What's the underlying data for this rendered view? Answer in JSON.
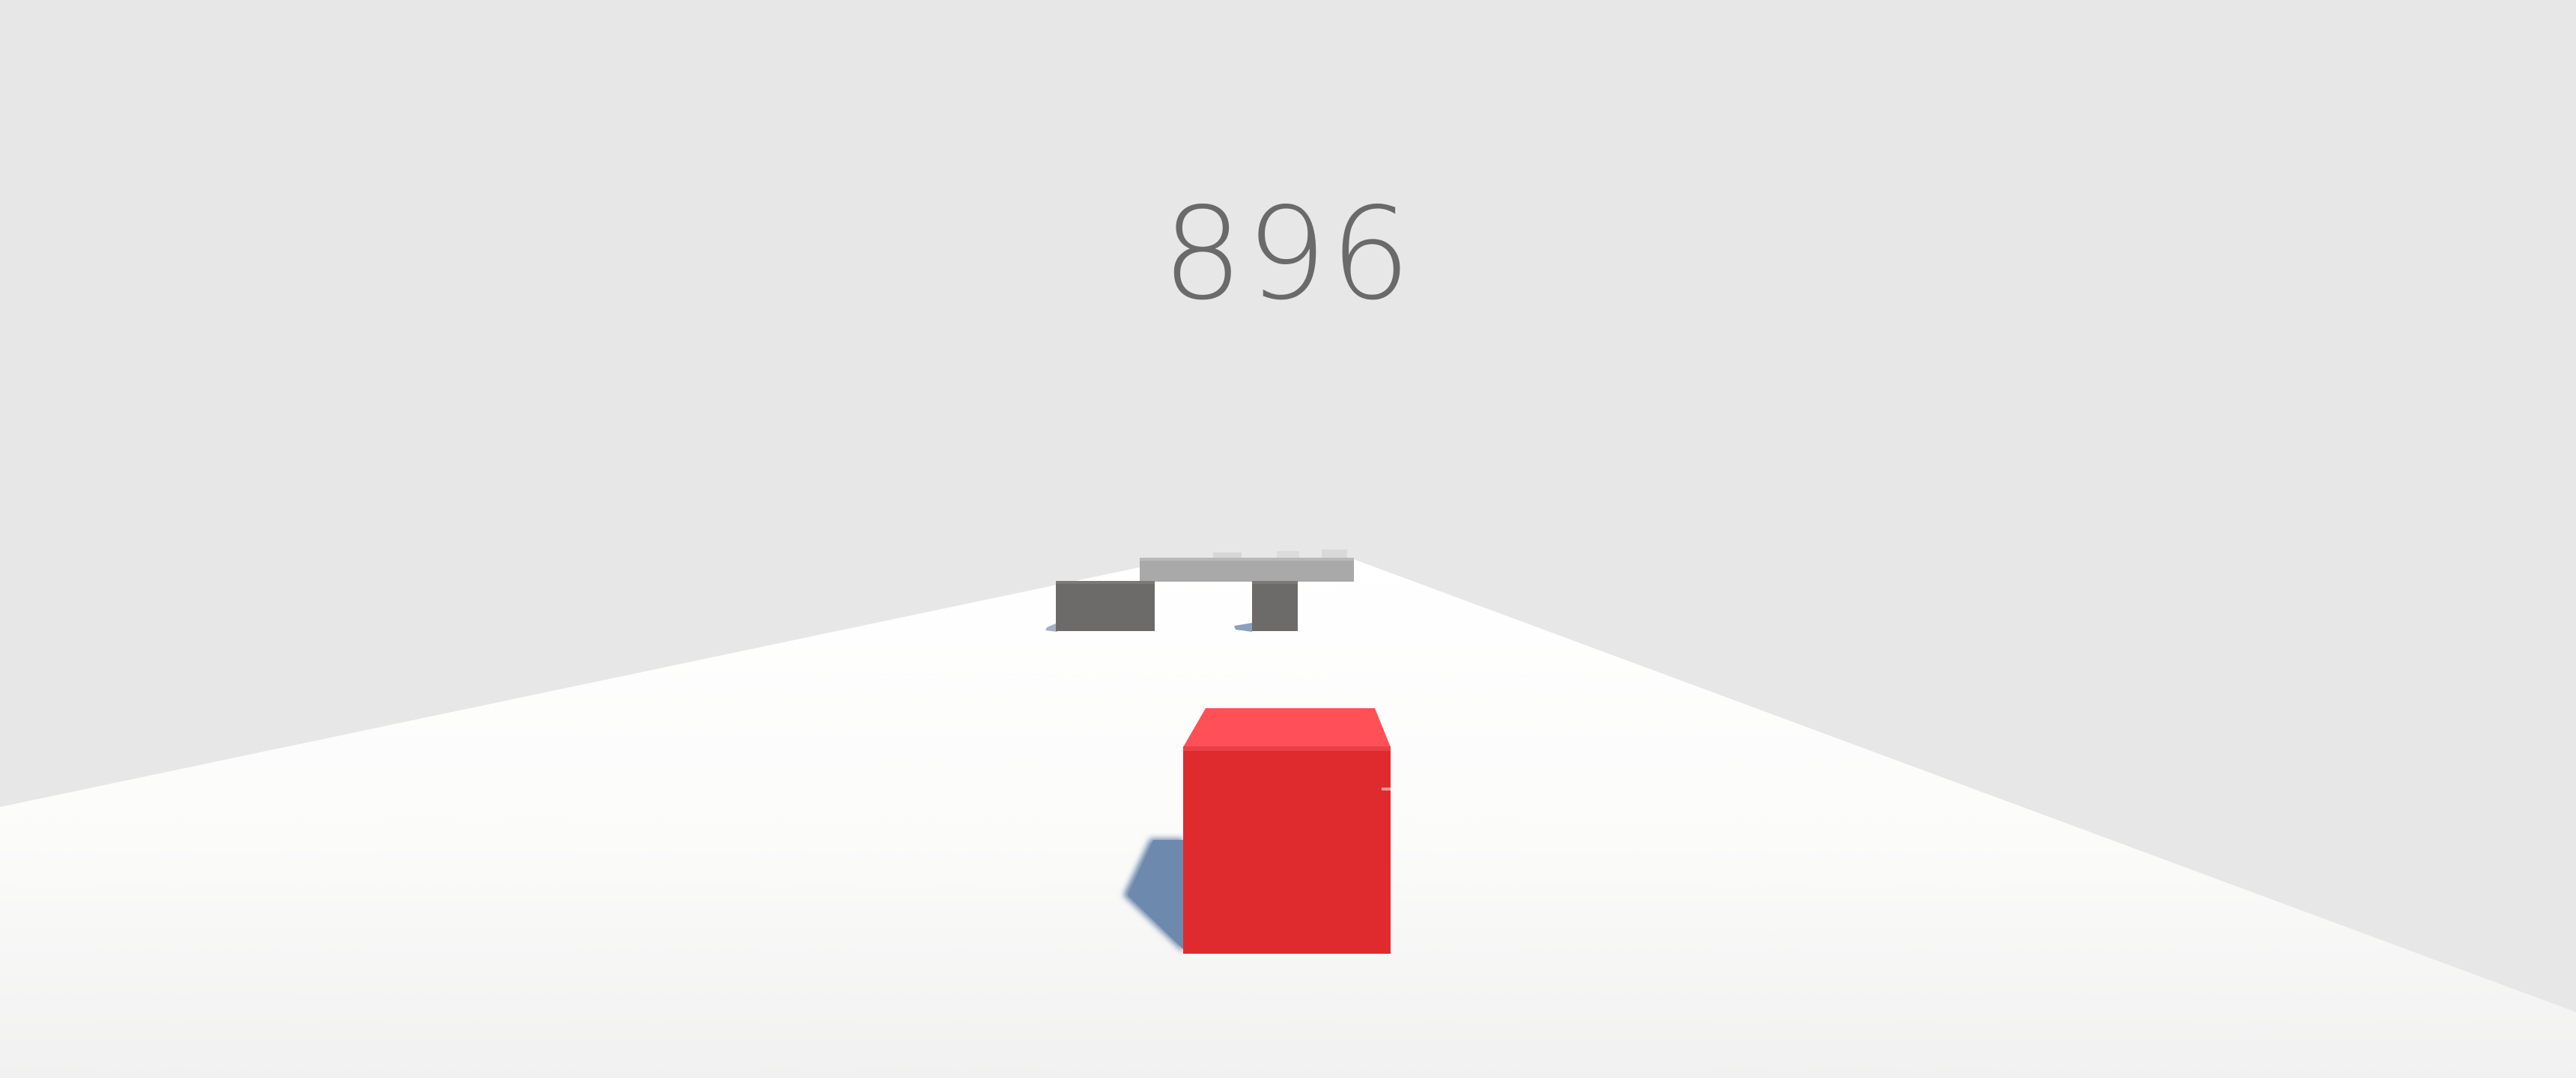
{
  "hud": {
    "score": "896"
  },
  "colors": {
    "sky": "#e7e7e7",
    "ground": "#ffffff",
    "player_front": "#e02b2e",
    "player_top": "#ff5058",
    "player_shadow": "#6d88ad",
    "obstacle": "#6c6b69",
    "far_obstacle": "#a9a9a9"
  },
  "scene": {
    "player": "red-cube",
    "obstacles": [
      "dark-gray-block",
      "dark-gray-block",
      "light-gray-bar"
    ]
  }
}
